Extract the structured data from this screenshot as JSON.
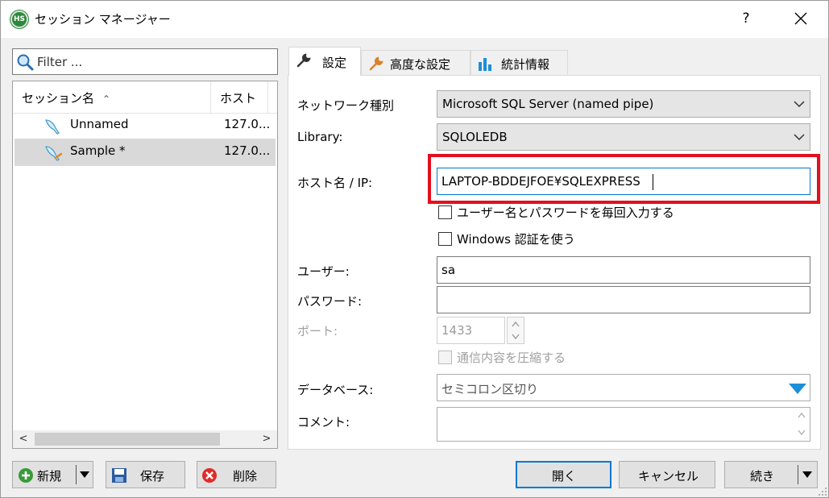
{
  "window": {
    "title": "セッション マネージャー",
    "help": "?"
  },
  "left": {
    "filter_placeholder": "Filter ...",
    "columns": {
      "name": "セッション名",
      "host": "ホスト"
    },
    "sessions": [
      {
        "name": "Unnamed",
        "host": "127.0..."
      },
      {
        "name": "Sample *",
        "host": "127.0..."
      }
    ],
    "buttons": {
      "new": "新規",
      "save": "保存",
      "delete": "削除"
    }
  },
  "tabs": [
    "設定",
    "高度な設定",
    "統計情報"
  ],
  "form": {
    "network_type_label": "ネットワーク種別",
    "network_type": "Microsoft SQL Server (named pipe)",
    "library_label": "Library:",
    "library": "SQLOLEDB",
    "host_label": "ホスト名 / IP:",
    "host": "LAPTOP-BDDEJFOE¥SQLEXPRESS",
    "prompt_credentials": "ユーザー名とパスワードを毎回入力する",
    "windows_auth": "Windows 認証を使う",
    "user_label": "ユーザー:",
    "user": "sa",
    "password_label": "パスワード:",
    "password": "",
    "port_label": "ポート:",
    "port": "1433",
    "compress": "通信内容を圧縮する",
    "database_label": "データベース:",
    "database_placeholder": "セミコロン区切り",
    "comment_label": "コメント:",
    "comment": ""
  },
  "footer": {
    "open": "開く",
    "cancel": "キャンセル",
    "more": "続き"
  },
  "colors": {
    "highlight": "#e2101e",
    "accent": "#0078d7",
    "selection": "#d9d9d9"
  }
}
